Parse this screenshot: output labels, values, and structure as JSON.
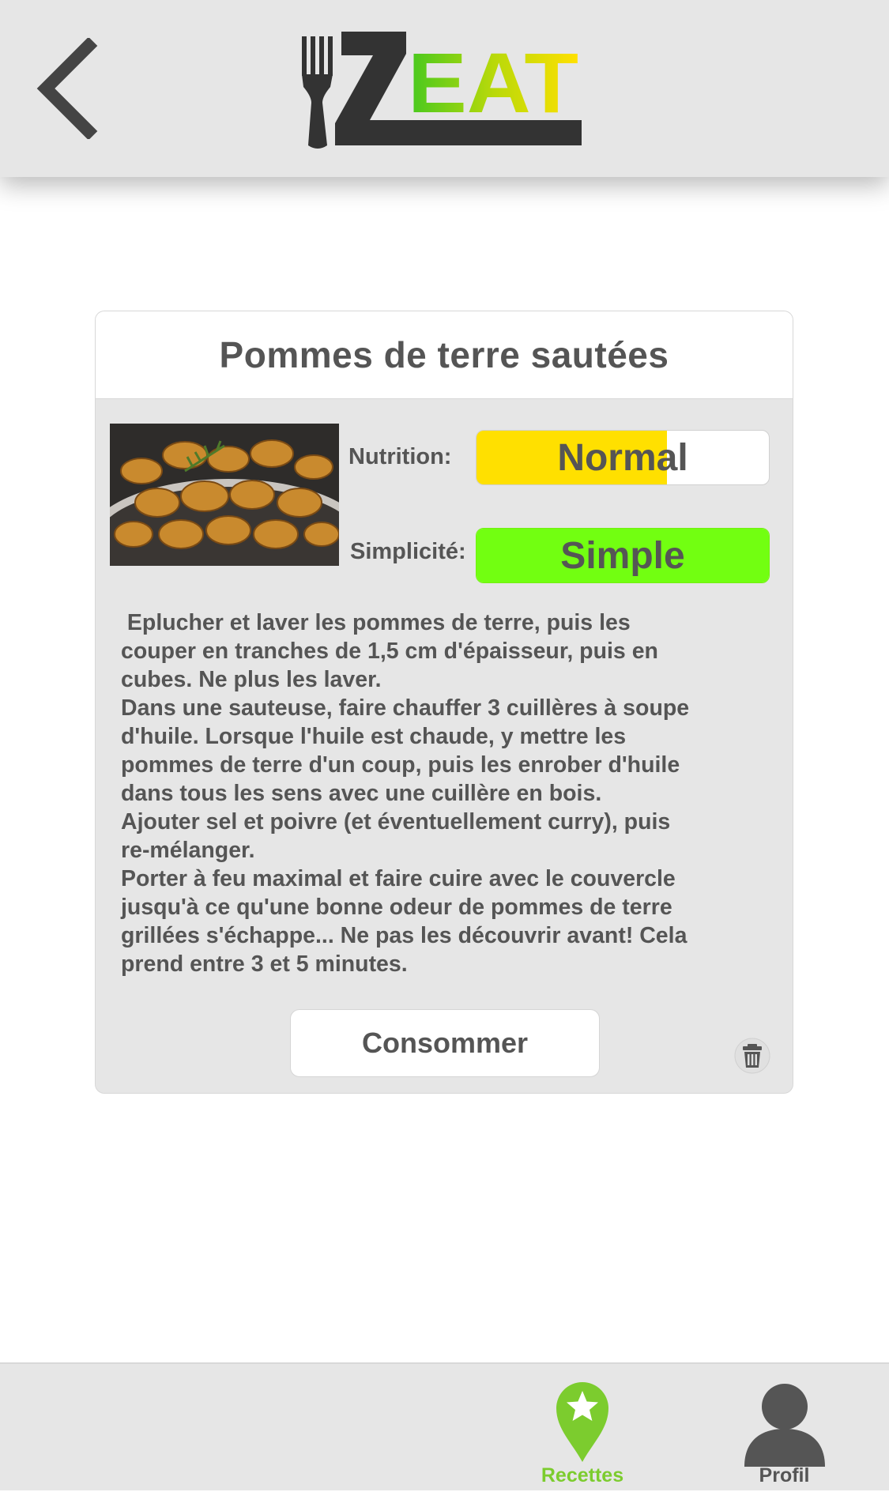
{
  "header": {
    "back_icon": "chevron-left-icon",
    "logo": {
      "text_z": "Z",
      "text_eat": "EAT",
      "icon": "fork-icon"
    }
  },
  "recipe": {
    "title": "Pommes de terre sautées",
    "image_alt": "potatoes-photo",
    "nutrition": {
      "label": "Nutrition:",
      "value": "Normal",
      "level": 0.65,
      "color": "#ffe000"
    },
    "simplicite": {
      "label": "Simplicité:",
      "value": "Simple",
      "level": 1.0,
      "color": "#72ff11"
    },
    "instructions": " Eplucher et laver les pommes de terre, puis les\ncouper en tranches de 1,5 cm d'épaisseur, puis en\ncubes. Ne plus les laver.\nDans une sauteuse, faire chauffer 3 cuillères à soupe\nd'huile. Lorsque l'huile est chaude, y mettre les\npommes de terre d'un coup, puis les enrober d'huile\ndans tous les sens avec une cuillère en bois.\nAjouter sel et poivre (et éventuellement curry), puis\nre-mélanger.\nPorter à feu maximal et faire cuire avec le couvercle\njusqu'à ce qu'une bonne odeur de pommes de terre\ngrillées s'échappe... Ne pas les découvrir avant! Cela\nprend entre 3 et 5 minutes.",
    "consume_label": "Consommer",
    "delete_icon": "trash-icon"
  },
  "bottom_nav": {
    "items": [
      {
        "label": "Recettes",
        "icon": "star-pin-icon",
        "active": true,
        "color": "#7ccc2e"
      },
      {
        "label": "Profil",
        "icon": "user-icon",
        "active": false,
        "color": "#555555"
      }
    ]
  }
}
